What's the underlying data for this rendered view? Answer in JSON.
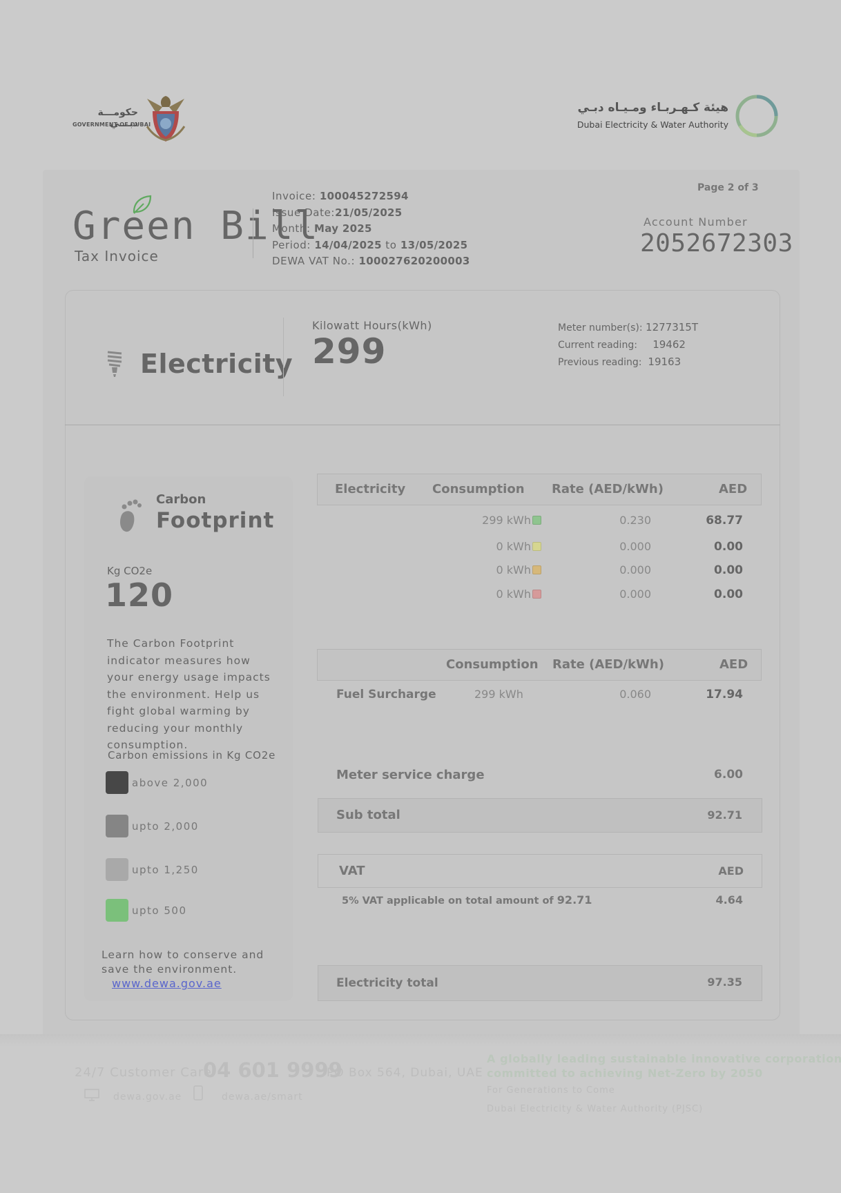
{
  "gov": {
    "name_ar": "حكومـــة دبـــي",
    "name_en": "GOVERNMENT OF DUBAI"
  },
  "dewa": {
    "name_ar": "هيئة كـهـربـاء ومـيـاه دبـي",
    "name_en": "Dubai Electricity & Water Authority"
  },
  "header": {
    "title": "Green Bill",
    "subtitle": "Tax Invoice",
    "invoice_label": "Invoice: ",
    "invoice_value": "100045272594",
    "issue_label": "Issue Date:",
    "issue_value": "21/05/2025",
    "month_label": "Month: ",
    "month_value": "May 2025",
    "period_label": "Period: ",
    "period_from": "14/04/2025",
    "period_to_word": " to ",
    "period_to": "13/05/2025",
    "vat_label": "DEWA VAT No.: ",
    "vat_value": "100027620200003",
    "page": "Page 2 of 3",
    "account_label": "Account Number",
    "account_number": "2052672303"
  },
  "electricity": {
    "title": "Electricity",
    "kwh_label": "Kilowatt Hours(kWh)",
    "kwh_value": "299",
    "meter_label": "Meter number(s):",
    "meter_value": "1277315T",
    "current_label": "Current reading:",
    "current_value": "19462",
    "previous_label": "Previous reading:",
    "previous_value": "19163"
  },
  "carbon": {
    "title_small": "Carbon",
    "title_big": "Footprint",
    "kg_label": "Kg CO2e",
    "kg_value": "120",
    "description": "The Carbon Footprint indicator measures how your energy usage impacts the environment. Help us fight global warming by reducing your monthly consumption.",
    "emissions_title": "Carbon emissions in Kg CO2e",
    "legend": [
      {
        "label": "above 2,000",
        "color": "#474747"
      },
      {
        "label": "upto 2,000",
        "color": "#858585"
      },
      {
        "label": "upto 1,250",
        "color": "#a9a9a9"
      },
      {
        "label": "upto 500",
        "color": "#7bc07b"
      }
    ],
    "learn": "Learn how to conserve and save the environment.",
    "link": "www.dewa.gov.ae"
  },
  "consumption_table": {
    "headers": [
      "Electricity",
      "Consumption",
      "Rate (AED/kWh)",
      "AED"
    ],
    "rows": [
      {
        "consumption": "299 kWh",
        "dot": "#8fc48f",
        "rate": "0.230",
        "aed": "68.77"
      },
      {
        "consumption": "0 kWh",
        "dot": "#d6d690",
        "rate": "0.000",
        "aed": "0.00"
      },
      {
        "consumption": "0 kWh",
        "dot": "#d6b87a",
        "rate": "0.000",
        "aed": "0.00"
      },
      {
        "consumption": "0 kWh",
        "dot": "#d69a9a",
        "rate": "0.000",
        "aed": "0.00"
      }
    ]
  },
  "fuel_table": {
    "headers": [
      "Consumption",
      "Rate (AED/kWh)",
      "AED"
    ],
    "label": "Fuel Surcharge",
    "consumption": "299 kWh",
    "rate": "0.060",
    "aed": "17.94"
  },
  "charges": {
    "meter_service_label": "Meter service charge",
    "meter_service_value": "6.00",
    "subtotal_label": "Sub total",
    "subtotal_value": "92.71",
    "vat_label": "VAT",
    "vat_currency": "AED",
    "vat_desc_prefix": "5% VAT applicable on total amount of ",
    "vat_desc_amount": "92.71",
    "vat_value": "4.64",
    "total_label": "Electricity total",
    "total_value": "97.35"
  },
  "footer": {
    "care_label": "24/7 Customer Care",
    "phone": "04 601 9999",
    "po_box": "PO Box 564, Dubai, UAE",
    "website": "dewa.gov.ae",
    "app": "dewa.ae/smart",
    "slogan1": "A globally leading sustainable innovative corporation",
    "slogan2": "committed to achieving Net-Zero by 2050",
    "tagline": "For Generations to Come",
    "company": "Dubai Electricity & Water Authority (PJSC)"
  }
}
